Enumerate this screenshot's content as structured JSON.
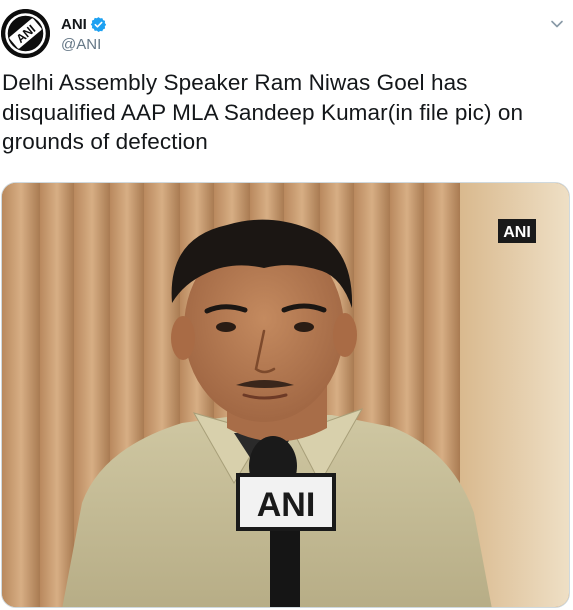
{
  "account": {
    "display_name": "ANI",
    "handle": "@ANI",
    "verified": true,
    "avatar_text": "ANI",
    "avatar_icon": "ani-logo-avatar",
    "verified_icon": "verified-badge-icon",
    "menu_icon": "chevron-down-icon"
  },
  "tweet": {
    "text": "Delhi Assembly Speaker Ram Niwas Goel has disqualified AAP MLA Sandeep Kumar(in file pic) on grounds of defection"
  },
  "media": {
    "watermark": "ANI",
    "mic_label": "ANI"
  },
  "colors": {
    "text": "#14171a",
    "secondary": "#657786",
    "verified_blue": "#1da1f2",
    "border": "#cfd9de"
  }
}
